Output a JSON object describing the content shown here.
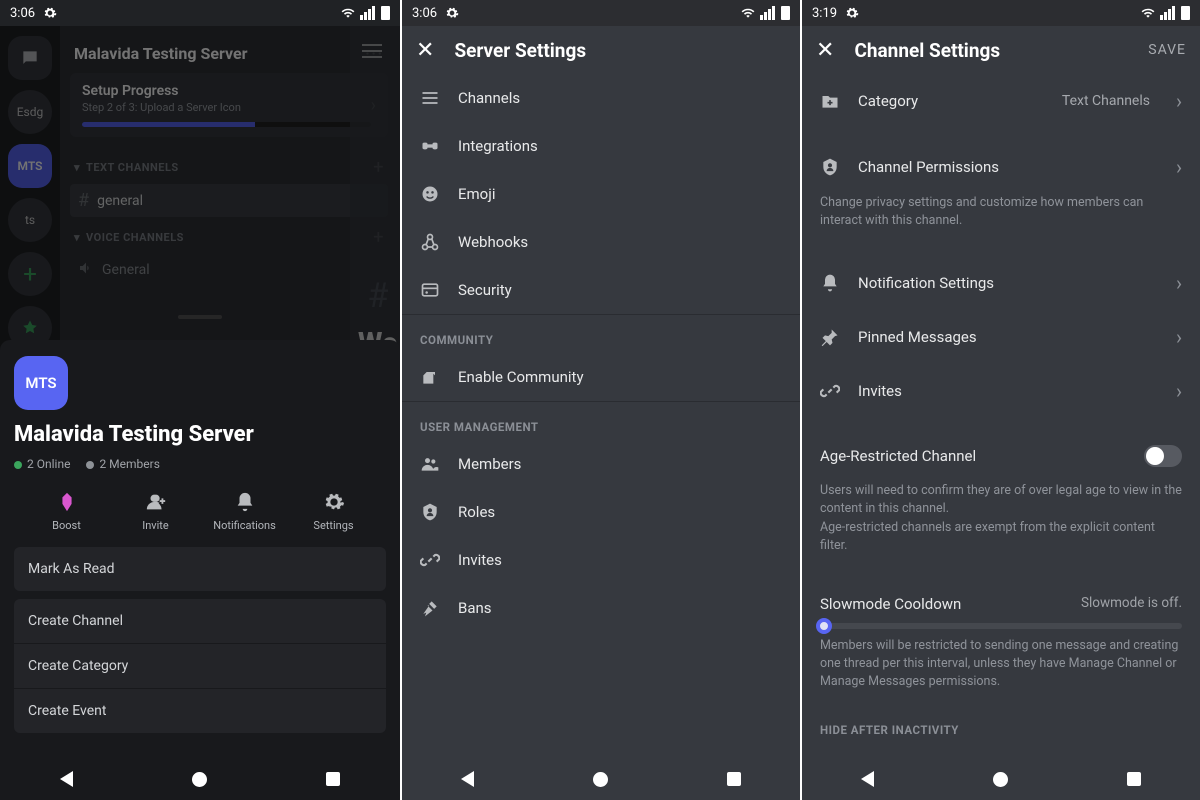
{
  "status": {
    "time1": "3:06",
    "time2": "3:06",
    "time3": "3:19"
  },
  "panel1": {
    "servers": [
      "",
      "Esdg",
      "MTS",
      "ts",
      "+",
      ""
    ],
    "server_name": "Malavida Testing Server",
    "more": "···",
    "setup": {
      "title": "Setup Progress",
      "sub": "Step 2 of 3: Upload a Server Icon"
    },
    "text_channels_label": "TEXT CHANNELS",
    "voice_channels_label": "VOICE CHANNELS",
    "channel_general": "general",
    "voice_general": "General",
    "chat_welcome_partial": "We",
    "sheet": {
      "icon_text": "MTS",
      "title": "Malavida Testing Server",
      "online": "2 Online",
      "members": "2 Members",
      "actions": {
        "boost": "Boost",
        "invite": "Invite",
        "notifications": "Notifications",
        "settings": "Settings"
      },
      "mark_read": "Mark As Read",
      "create_channel": "Create Channel",
      "create_category": "Create Category",
      "create_event": "Create Event"
    }
  },
  "panel2": {
    "title": "Server Settings",
    "items1": [
      "Channels",
      "Integrations",
      "Emoji",
      "Webhooks",
      "Security"
    ],
    "community_label": "COMMUNITY",
    "items2": [
      "Enable Community"
    ],
    "user_mgmt_label": "USER MANAGEMENT",
    "items3": [
      "Members",
      "Roles",
      "Invites",
      "Bans"
    ]
  },
  "panel3": {
    "title": "Channel Settings",
    "save": "SAVE",
    "category": {
      "label": "Category",
      "value": "Text Channels"
    },
    "permissions": {
      "label": "Channel Permissions",
      "desc": "Change privacy settings and customize how members can interact with this channel."
    },
    "notif": "Notification Settings",
    "pinned": "Pinned Messages",
    "invites": "Invites",
    "age": {
      "label": "Age-Restricted Channel",
      "desc": "Users will need to confirm they are of over legal age to view in the content in this channel.\nAge-restricted channels are exempt from the explicit content filter."
    },
    "slowmode": {
      "label": "Slowmode Cooldown",
      "value": "Slowmode is off.",
      "desc": "Members will be restricted to sending one message and creating one thread per this interval, unless they have Manage Channel or Manage Messages permissions."
    },
    "hide_label": "HIDE AFTER INACTIVITY"
  }
}
